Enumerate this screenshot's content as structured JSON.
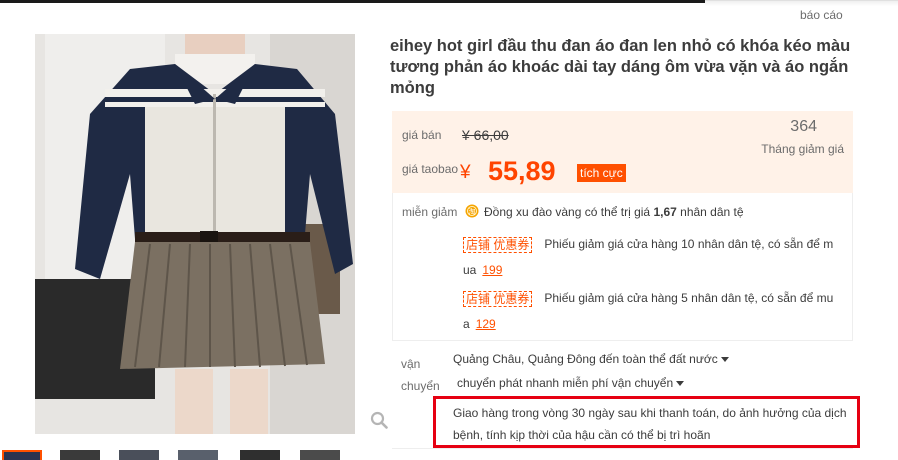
{
  "header": {
    "report_label": "báo cáo"
  },
  "product": {
    "title": "eihey hot girl đầu thu đan áo đan len nhỏ có khóa kéo màu tương phản áo khoác dài tay dáng ôm vừa vặn và áo ngắn mỏng"
  },
  "price": {
    "list_label": "giá bán",
    "list_price": "¥ 66,00",
    "taobao_label": "giá taobao",
    "currency": "¥",
    "taobao_price": "55,89",
    "promo_tag": "tích cực",
    "sold_count": "364",
    "sold_label": "Tháng giảm giá"
  },
  "discounts": {
    "label": "miễn giảm",
    "coin_text_prefix": "Đồng xu đào vàng có thể trị giá",
    "coin_value": "1,67",
    "coin_text_suffix": "nhân dân tệ",
    "coupons": [
      {
        "tag": "店铺 优惠券",
        "text_a": "Phiếu giảm giá cửa hàng 10 nhân dân tệ, có sẵn để m",
        "text_b": "ua",
        "amount": "199"
      },
      {
        "tag": "店铺 优惠券",
        "text_a": "Phiếu giảm giá cửa hàng 5 nhân dân tệ, có sẵn để mu",
        "text_b": "a",
        "amount": "129"
      }
    ]
  },
  "shipping": {
    "label": "vận chuyển",
    "route": "Quảng Châu, Quảng Đông đến toàn thể đất nước",
    "method": "chuyển phát nhanh miễn phí vận chuyển",
    "notice_line1": "Giao hàng trong vòng 30 ngày sau khi thanh toán, do ảnh hưởng của dịch",
    "notice_line2": "bệnh, tính kịp thời của hậu cần có thể bị trì hoãn"
  },
  "colors": {
    "accent": "#ff5000",
    "price": "#ff4400",
    "highlight_border": "#e60012",
    "price_bg": "#fff2e8"
  },
  "icons": {
    "zoom": "magnifier-icon",
    "coin": "gold-coin-icon",
    "dropdown": "caret-down-icon"
  }
}
